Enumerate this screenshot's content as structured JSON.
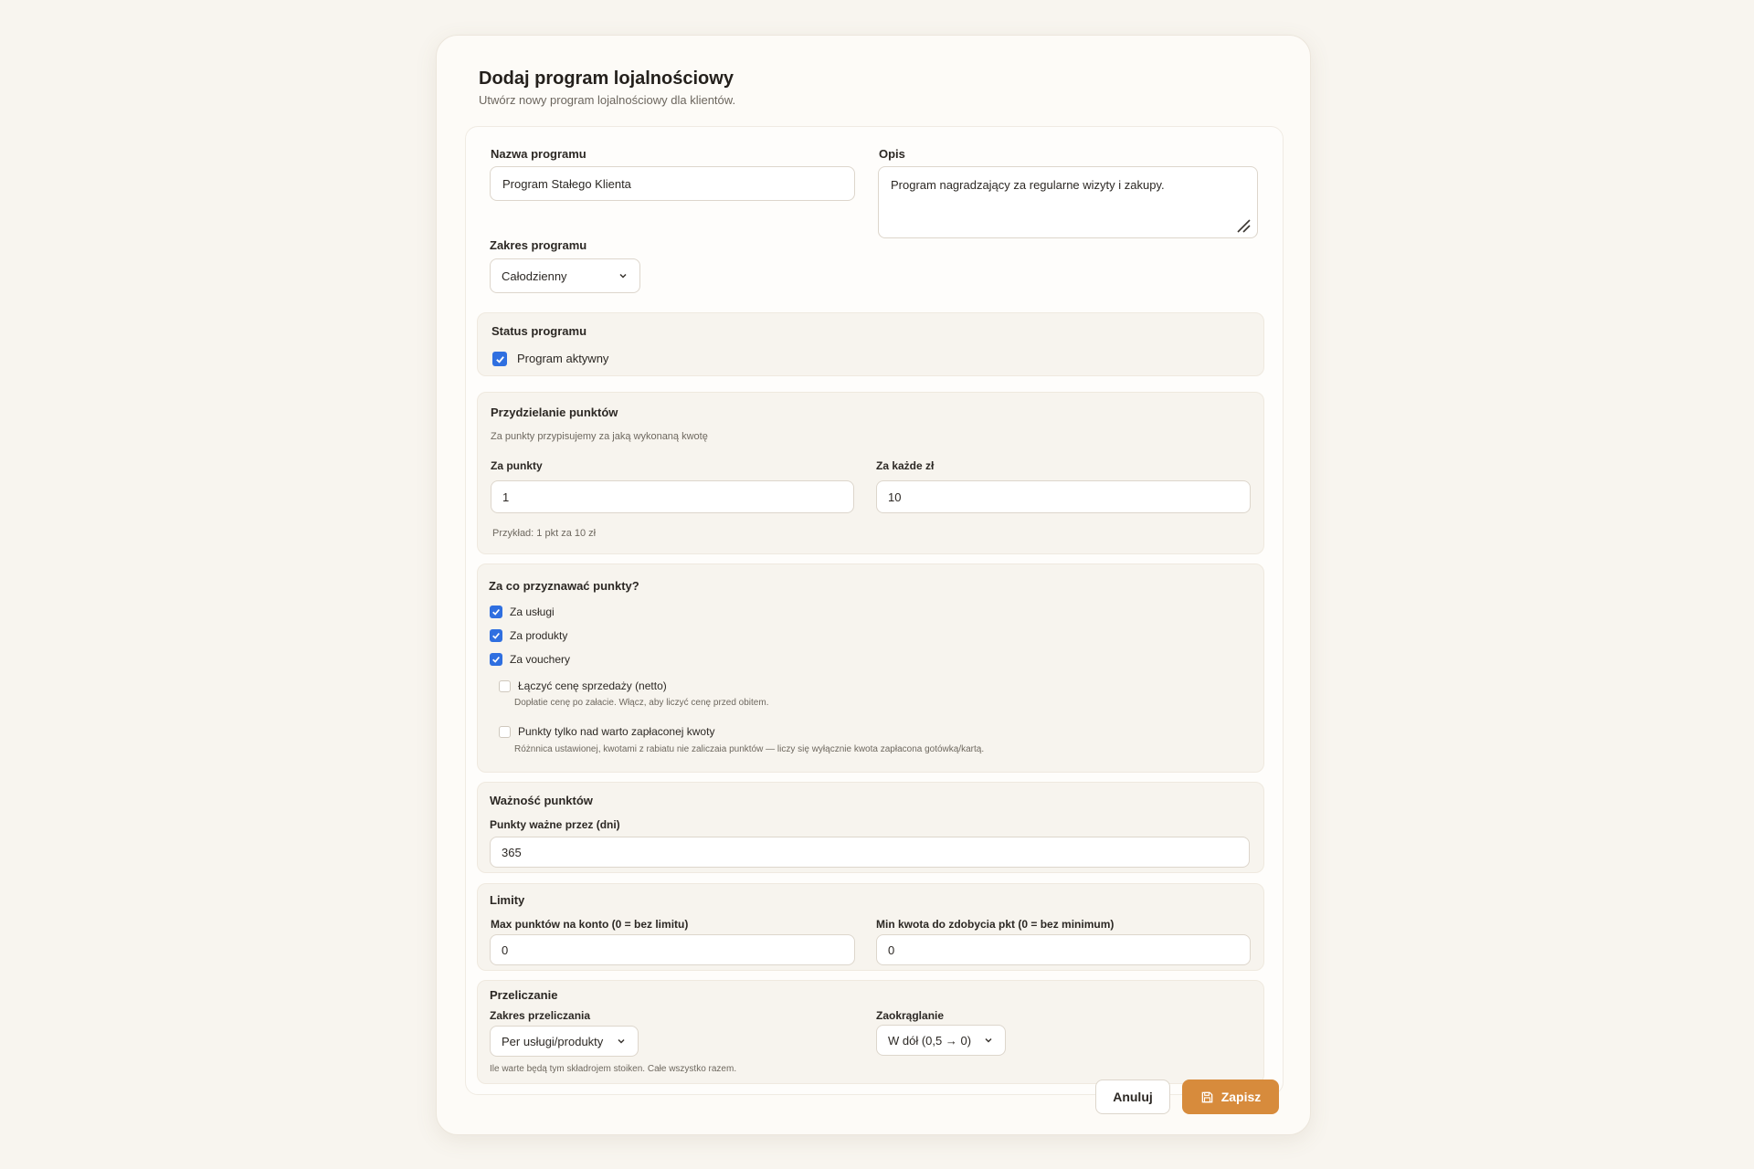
{
  "dialog": {
    "title": "Dodaj program lojalnościowy",
    "subtitle": "Utwórz nowy program lojalnościowy dla klientów."
  },
  "basic": {
    "name_label": "Nazwa programu",
    "name_value": "Program Stałego Klienta",
    "desc_label": "Opis",
    "desc_value": "Program nagradzający za regularne wizyty i zakupy.",
    "scope_label": "Zakres programu",
    "scope_value": "Całodzienny"
  },
  "status": {
    "title": "Status programu",
    "active_label": "Program aktywny",
    "active_checked": true
  },
  "points": {
    "title": "Przydzielanie punktów",
    "hint": "Za punkty przypisujemy za jaką wykonaną kwotę",
    "points_label": "Za punkty",
    "points_value": "1",
    "per_label": "Za każde zł",
    "per_value": "10",
    "example": "Przykład: 1 pkt za 10 zł"
  },
  "award": {
    "title": "Za co przyznawać punkty?",
    "services_label": "Za usługi",
    "products_label": "Za produkty",
    "vouchers_label": "Za vouchery",
    "net_label": "Łączyć cenę sprzedaży (netto)",
    "net_hint": "Dopłatie cenę po załacie. Włącz, aby liczyć cenę przed obitem.",
    "paid_label": "Punkty tylko nad warto zapłaconej kwoty",
    "paid_hint": "Różnnica ustawionej, kwotami z rabiatu nie zaliczaia punktów — liczy się wyłącznie kwota zapłacona gotówką/kartą."
  },
  "validity": {
    "title": "Ważność punktów",
    "days_label": "Punkty ważne przez (dni)",
    "days_value": "365"
  },
  "limits": {
    "title": "Limity",
    "max_label": "Max punktów na konto (0 = bez limitu)",
    "max_value": "0",
    "min_label": "Min kwota do zdobycia pkt (0 = bez minimum)",
    "min_value": "0"
  },
  "recalc": {
    "title": "Przeliczanie",
    "scope_label": "Zakres przeliczania",
    "scope_value": "Per usługi/produkty",
    "rounding_label": "Zaokrąglanie",
    "rounding_value": "W dół (0,5 → 0)",
    "hint": "Ile warte będą tym składrojem stoiken. Całe wszystko razem."
  },
  "actions": {
    "cancel_label": "Anuluj",
    "save_label": "Zapisz"
  },
  "colors": {
    "accent": "#d78b3c",
    "checkbox": "#2f6fe0",
    "background": "#f8f5ef"
  },
  "icons": {
    "save": "save-icon",
    "chevron": "chevron-down-icon",
    "check": "check-icon",
    "resize": "resize-handle-icon"
  }
}
